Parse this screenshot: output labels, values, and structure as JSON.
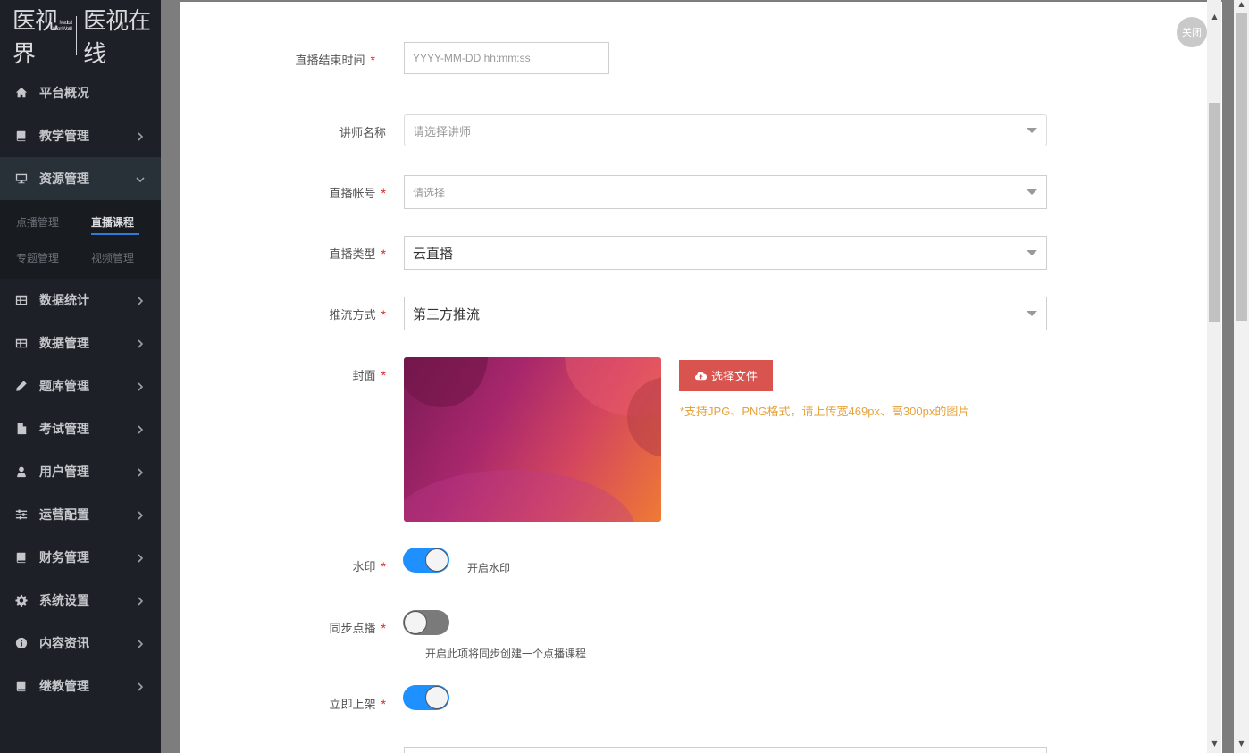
{
  "brand": {
    "small_line1": "Medical",
    "small_line2": "Vision World",
    "left": "医视界",
    "right": "医视在线"
  },
  "sidebar": {
    "items": [
      {
        "label": "平台概况",
        "icon": "home-icon"
      },
      {
        "label": "教学管理",
        "icon": "book-icon"
      },
      {
        "label": "资源管理",
        "icon": "monitor-icon"
      },
      {
        "label": "数据统计",
        "icon": "table-icon"
      },
      {
        "label": "数据管理",
        "icon": "table-icon"
      },
      {
        "label": "题库管理",
        "icon": "pencil-icon"
      },
      {
        "label": "考试管理",
        "icon": "file-icon"
      },
      {
        "label": "用户管理",
        "icon": "user-icon"
      },
      {
        "label": "运营配置",
        "icon": "sliders-icon"
      },
      {
        "label": "财务管理",
        "icon": "book-icon"
      },
      {
        "label": "系统设置",
        "icon": "gear-icon"
      },
      {
        "label": "内容资讯",
        "icon": "info-icon"
      },
      {
        "label": "继教管理",
        "icon": "book-icon"
      }
    ],
    "subitems": [
      "点播管理",
      "直播课程",
      "专题管理",
      "视频管理"
    ],
    "active_subitem": "直播课程"
  },
  "modal": {
    "close_label": "关闭",
    "required_mark": "*",
    "fields": {
      "end_time": {
        "label": "直播结束时间",
        "placeholder": "YYYY-MM-DD hh:mm:ss"
      },
      "lecturer": {
        "label": "讲师名称",
        "placeholder": "请选择讲师"
      },
      "account": {
        "label": "直播帐号",
        "placeholder": "请选择"
      },
      "live_type": {
        "label": "直播类型",
        "value": "云直播"
      },
      "push_method": {
        "label": "推流方式",
        "value": "第三方推流"
      },
      "cover": {
        "label": "封面",
        "upload_label": "选择文件",
        "hint": "*支持JPG、PNG格式，请上传宽469px、高300px的图片"
      },
      "watermark": {
        "label": "水印",
        "state": "on",
        "caption": "开启水印"
      },
      "sync_vod": {
        "label": "同步点播",
        "state": "off",
        "caption": "开启此项将同步创建一个点播课程"
      },
      "publish_now": {
        "label": "立即上架",
        "state": "on"
      }
    }
  },
  "colors": {
    "sidebar_bg": "#1d2127",
    "accent": "#1e90ff",
    "upload_button": "#d9534f",
    "hint": "#e6a23c",
    "required": "#e02424"
  }
}
